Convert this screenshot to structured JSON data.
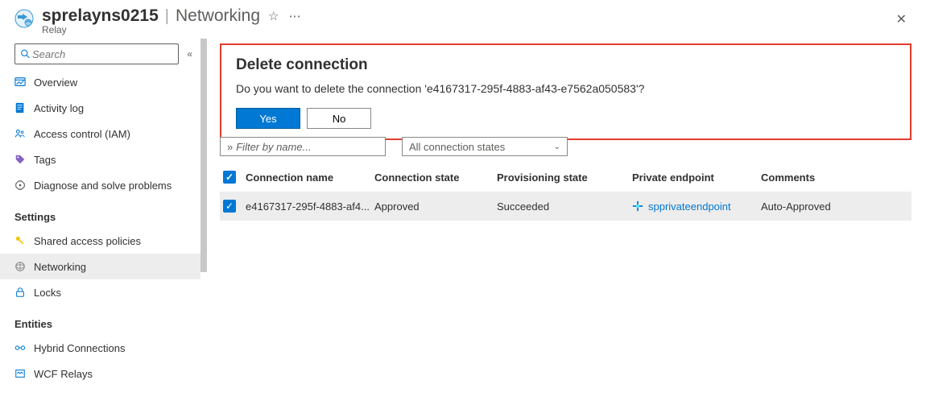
{
  "header": {
    "resource_name": "sprelayns0215",
    "section": "Networking",
    "resource_type": "Relay"
  },
  "search": {
    "placeholder": "Search"
  },
  "sidebar": {
    "items": [
      {
        "label": "Overview"
      },
      {
        "label": "Activity log"
      },
      {
        "label": "Access control (IAM)"
      },
      {
        "label": "Tags"
      },
      {
        "label": "Diagnose and solve problems"
      }
    ],
    "groups": [
      {
        "title": "Settings",
        "items": [
          {
            "label": "Shared access policies"
          },
          {
            "label": "Networking"
          },
          {
            "label": "Locks"
          }
        ]
      },
      {
        "title": "Entities",
        "items": [
          {
            "label": "Hybrid Connections"
          },
          {
            "label": "WCF Relays"
          }
        ]
      }
    ]
  },
  "dialog": {
    "title": "Delete connection",
    "message": "Do you want to delete the connection 'e4167317-295f-4883-af43-e7562a050583'?",
    "yes": "Yes",
    "no": "No"
  },
  "filters": {
    "name_placeholder": "Filter by name...",
    "state_label": "All connection states"
  },
  "table": {
    "headers": {
      "name": "Connection name",
      "state": "Connection state",
      "provisioning": "Provisioning state",
      "endpoint": "Private endpoint",
      "comments": "Comments"
    },
    "rows": [
      {
        "name": "e4167317-295f-4883-af4...",
        "state": "Approved",
        "provisioning": "Succeeded",
        "endpoint": "spprivateendpoint",
        "comments": "Auto-Approved"
      }
    ]
  }
}
